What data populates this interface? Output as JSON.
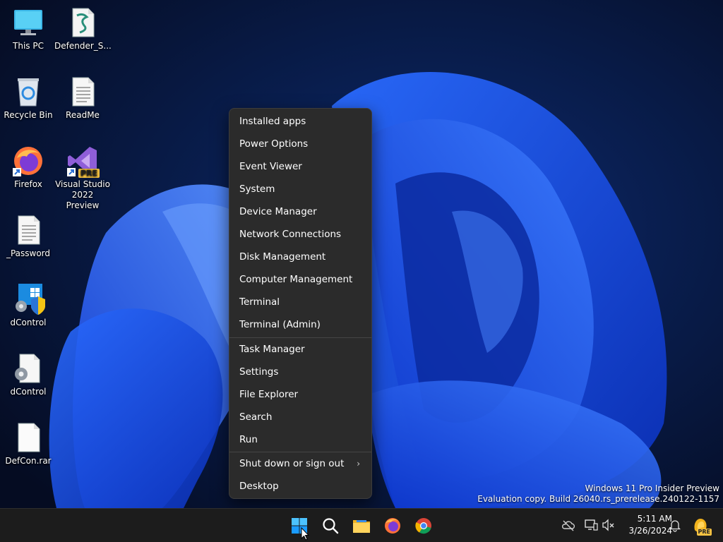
{
  "desktop": {
    "icons": [
      {
        "label": "This PC"
      },
      {
        "label": "Defender_S..."
      },
      {
        "label": "Recycle Bin"
      },
      {
        "label": "ReadMe"
      },
      {
        "label": "Firefox"
      },
      {
        "label": "Visual Studio 2022 Preview",
        "badge": "PRE"
      },
      {
        "label": "_Password"
      },
      {
        "label": "dControl"
      },
      {
        "label": "dControl"
      },
      {
        "label": "DefCon.rar"
      }
    ]
  },
  "context_menu": {
    "items": [
      "Installed apps",
      "Power Options",
      "Event Viewer",
      "System",
      "Device Manager",
      "Network Connections",
      "Disk Management",
      "Computer Management",
      "Terminal",
      "Terminal (Admin)",
      "Task Manager",
      "Settings",
      "File Explorer",
      "Search",
      "Run",
      "Shut down or sign out",
      "Desktop"
    ],
    "submenu_chevron": "›"
  },
  "watermark": {
    "line1": "Windows 11 Pro Insider Preview",
    "line2": "Evaluation copy. Build 26040.rs_prerelease.240122-1157"
  },
  "taskbar": {
    "pinned": [
      "start-icon",
      "search-icon",
      "file-explorer-icon",
      "firefox-icon",
      "chrome-icon"
    ],
    "clock": {
      "time": "5:11 AM",
      "date": "3/26/2024"
    },
    "tray_badge": "PRE"
  },
  "colors": {
    "menu_bg": "#2b2b2b",
    "taskbar_bg": "#1c1c1c",
    "accent": "#3a8ee6"
  }
}
